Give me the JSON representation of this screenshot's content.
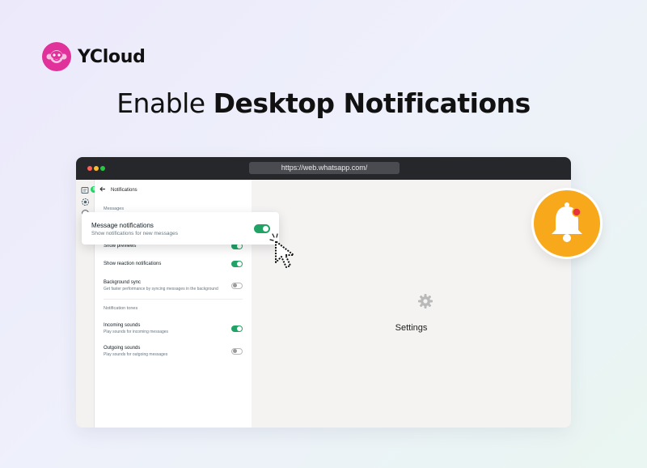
{
  "brand": {
    "name": "YCloud",
    "logo_icon": "monkey-logo-icon",
    "color": "#e0329a"
  },
  "headline": {
    "light": "Enable",
    "bold": "Desktop Notifications"
  },
  "browser": {
    "url": "https://web.whatsapp.com/"
  },
  "sidebar_rail": {
    "badge": "8"
  },
  "settings_panel": {
    "title": "Notifications",
    "section_messages": "Messages",
    "rows": [
      {
        "title": "Show previews",
        "enabled": true
      },
      {
        "title": "Show reaction notifications",
        "enabled": true
      },
      {
        "title": "Background sync",
        "subtitle": "Get faster performance by syncing messages in the background",
        "enabled": false
      }
    ],
    "section_tones": "Notification tones",
    "tone_rows": [
      {
        "title": "Incoming sounds",
        "subtitle": "Play sounds for incoming messages",
        "enabled": true
      },
      {
        "title": "Outgoing sounds",
        "subtitle": "Play sounds for outgoing messages",
        "enabled": false
      }
    ]
  },
  "popup": {
    "title": "Message notifications",
    "subtitle": "Show notifications for new messages",
    "enabled": true
  },
  "main": {
    "label": "Settings"
  },
  "colors": {
    "toggle_on": "#21a366",
    "bell": "#f7a81b",
    "accent": "#e0329a"
  }
}
